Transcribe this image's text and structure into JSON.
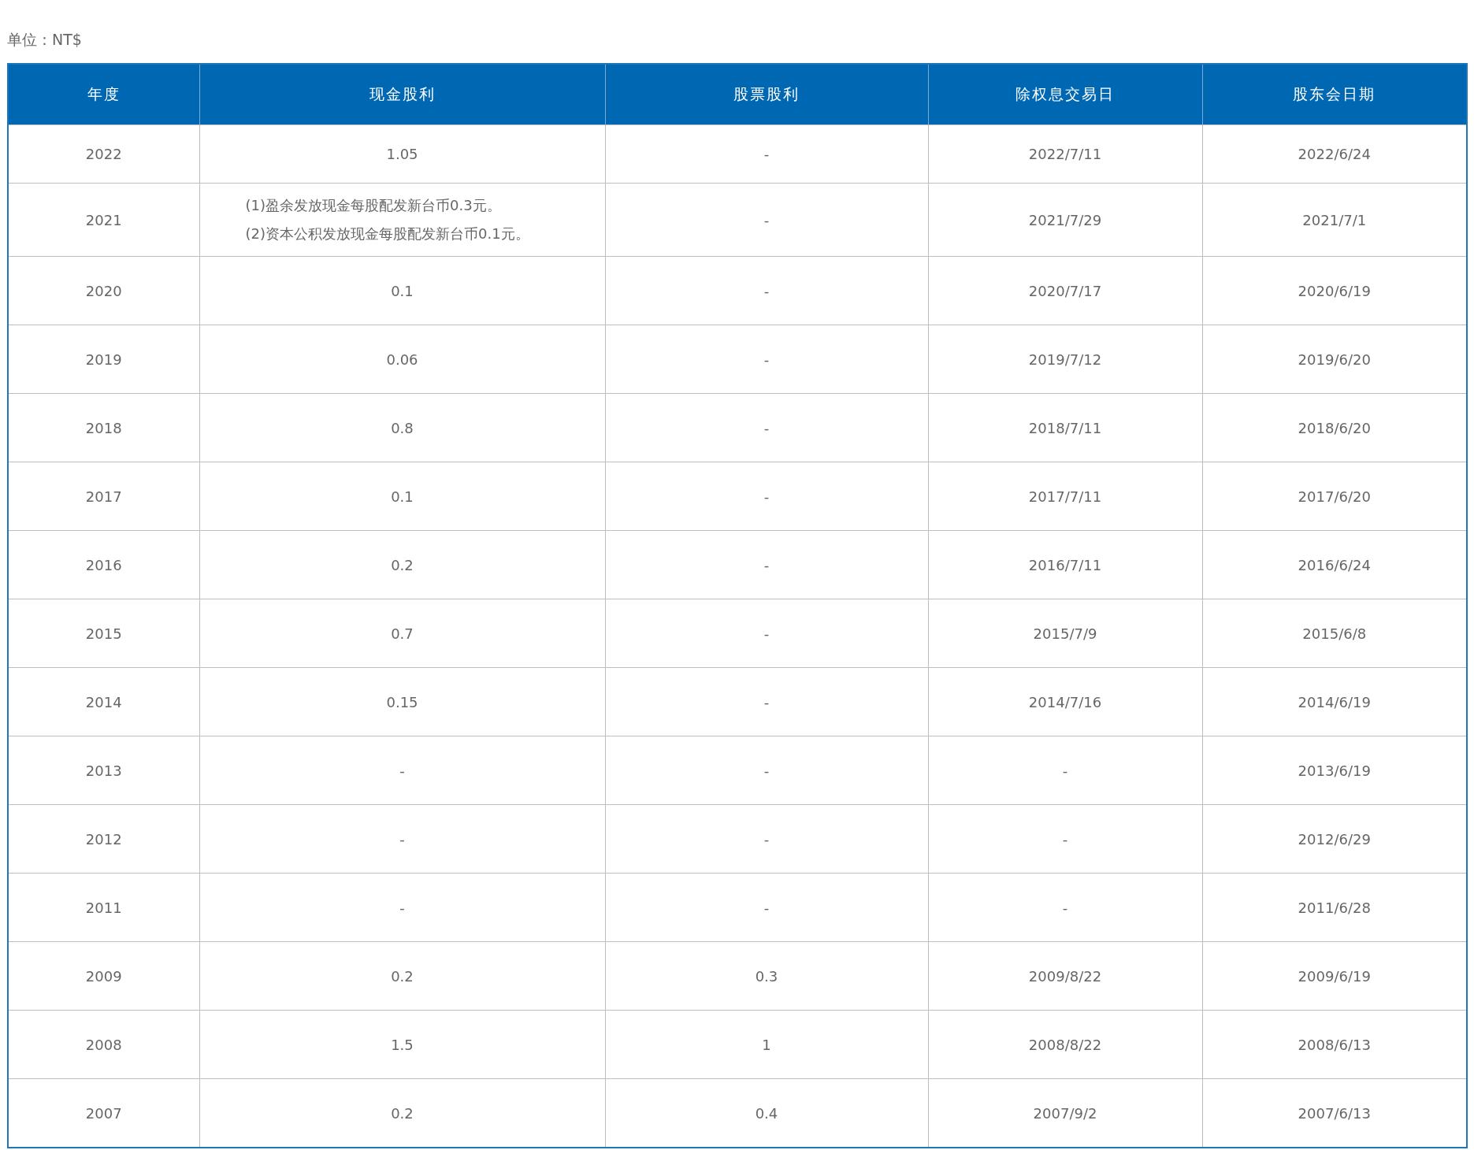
{
  "unit_label": "单位：NT$",
  "table": {
    "columns": [
      "年度",
      "现金股利",
      "股票股利",
      "除权息交易日",
      "股东会日期"
    ],
    "rows": [
      {
        "year": "2022",
        "cash_dividend": [
          "1.05"
        ],
        "stock_dividend": "-",
        "ex_dividend_date": "2022/7/11",
        "meeting_date": "2022/6/24"
      },
      {
        "year": "2021",
        "cash_dividend": [
          "(1)盈余发放现金每股配发新台币0.3元。",
          "(2)资本公积发放现金每股配发新台币0.1元。"
        ],
        "stock_dividend": "-",
        "ex_dividend_date": "2021/7/29",
        "meeting_date": "2021/7/1"
      },
      {
        "year": "2020",
        "cash_dividend": [
          "0.1"
        ],
        "stock_dividend": "-",
        "ex_dividend_date": "2020/7/17",
        "meeting_date": "2020/6/19"
      },
      {
        "year": "2019",
        "cash_dividend": [
          "0.06"
        ],
        "stock_dividend": "-",
        "ex_dividend_date": "2019/7/12",
        "meeting_date": "2019/6/20"
      },
      {
        "year": "2018",
        "cash_dividend": [
          "0.8"
        ],
        "stock_dividend": "-",
        "ex_dividend_date": "2018/7/11",
        "meeting_date": "2018/6/20"
      },
      {
        "year": "2017",
        "cash_dividend": [
          "0.1"
        ],
        "stock_dividend": "-",
        "ex_dividend_date": "2017/7/11",
        "meeting_date": "2017/6/20"
      },
      {
        "year": "2016",
        "cash_dividend": [
          "0.2"
        ],
        "stock_dividend": "-",
        "ex_dividend_date": "2016/7/11",
        "meeting_date": "2016/6/24"
      },
      {
        "year": "2015",
        "cash_dividend": [
          "0.7"
        ],
        "stock_dividend": "-",
        "ex_dividend_date": "2015/7/9",
        "meeting_date": "2015/6/8"
      },
      {
        "year": "2014",
        "cash_dividend": [
          "0.15"
        ],
        "stock_dividend": "-",
        "ex_dividend_date": "2014/7/16",
        "meeting_date": "2014/6/19"
      },
      {
        "year": "2013",
        "cash_dividend": [
          "-"
        ],
        "stock_dividend": "-",
        "ex_dividend_date": "-",
        "meeting_date": "2013/6/19"
      },
      {
        "year": "2012",
        "cash_dividend": [
          "-"
        ],
        "stock_dividend": "-",
        "ex_dividend_date": "-",
        "meeting_date": "2012/6/29"
      },
      {
        "year": "2011",
        "cash_dividend": [
          "-"
        ],
        "stock_dividend": "-",
        "ex_dividend_date": "-",
        "meeting_date": "2011/6/28"
      },
      {
        "year": "2009",
        "cash_dividend": [
          "0.2"
        ],
        "stock_dividend": "0.3",
        "ex_dividend_date": "2009/8/22",
        "meeting_date": "2009/6/19"
      },
      {
        "year": "2008",
        "cash_dividend": [
          "1.5"
        ],
        "stock_dividend": "1",
        "ex_dividend_date": "2008/8/22",
        "meeting_date": "2008/6/13"
      },
      {
        "year": "2007",
        "cash_dividend": [
          "0.2"
        ],
        "stock_dividend": "0.4",
        "ex_dividend_date": "2007/9/2",
        "meeting_date": "2007/6/13"
      }
    ]
  }
}
